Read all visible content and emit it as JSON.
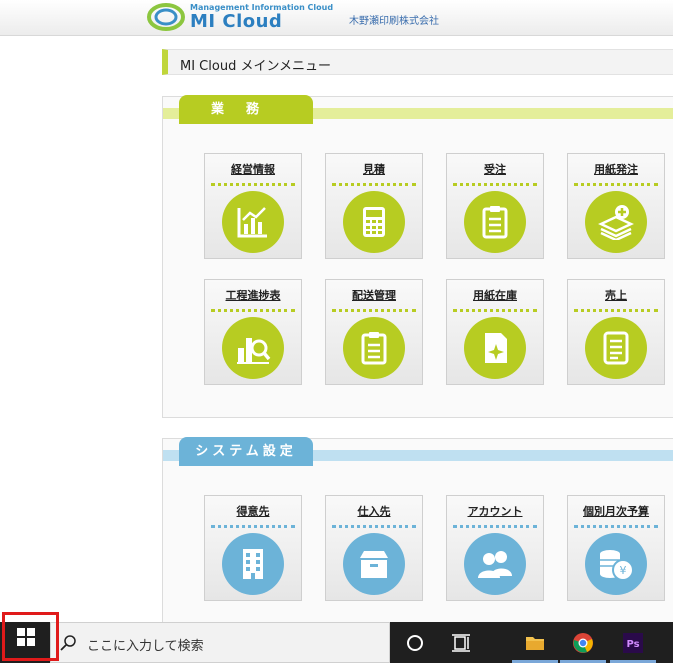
{
  "header": {
    "logo_sub": "Management Information Cloud",
    "logo_main": "MI Cloud",
    "company": "木野瀬印刷株式会社"
  },
  "menu_title": "MI Cloud メインメニュー",
  "sections": [
    {
      "title": "業務",
      "tiles": [
        {
          "label": "経営情報",
          "icon": "chart-icon"
        },
        {
          "label": "見積",
          "icon": "calculator-icon"
        },
        {
          "label": "受注",
          "icon": "clipboard-icon"
        },
        {
          "label": "用紙発注",
          "icon": "paper-stack-add-icon"
        },
        {
          "label": "工程進捗表",
          "icon": "progress-magnifier-icon"
        },
        {
          "label": "配送管理",
          "icon": "delivery-clipboard-icon"
        },
        {
          "label": "用紙在庫",
          "icon": "inventory-sparkle-icon"
        },
        {
          "label": "売上",
          "icon": "sales-list-icon"
        }
      ]
    },
    {
      "title": "システム設定",
      "tiles": [
        {
          "label": "得意先",
          "icon": "building-icon"
        },
        {
          "label": "仕入先",
          "icon": "box-icon"
        },
        {
          "label": "アカウント",
          "icon": "users-icon"
        },
        {
          "label": "個別月次予算",
          "icon": "yen-coins-icon"
        }
      ]
    }
  ],
  "taskbar": {
    "search_placeholder": "ここに入力して検索",
    "icons": [
      "windows-start-icon",
      "search-icon",
      "cortana-icon",
      "task-view-icon",
      "file-explorer-icon",
      "chrome-icon",
      "photoshop-icon"
    ]
  },
  "colors": {
    "work_accent": "#b7cc22",
    "system_accent": "#6cb3d8",
    "brand": "#2c7fc0",
    "start_highlight": "#e01a1a"
  }
}
